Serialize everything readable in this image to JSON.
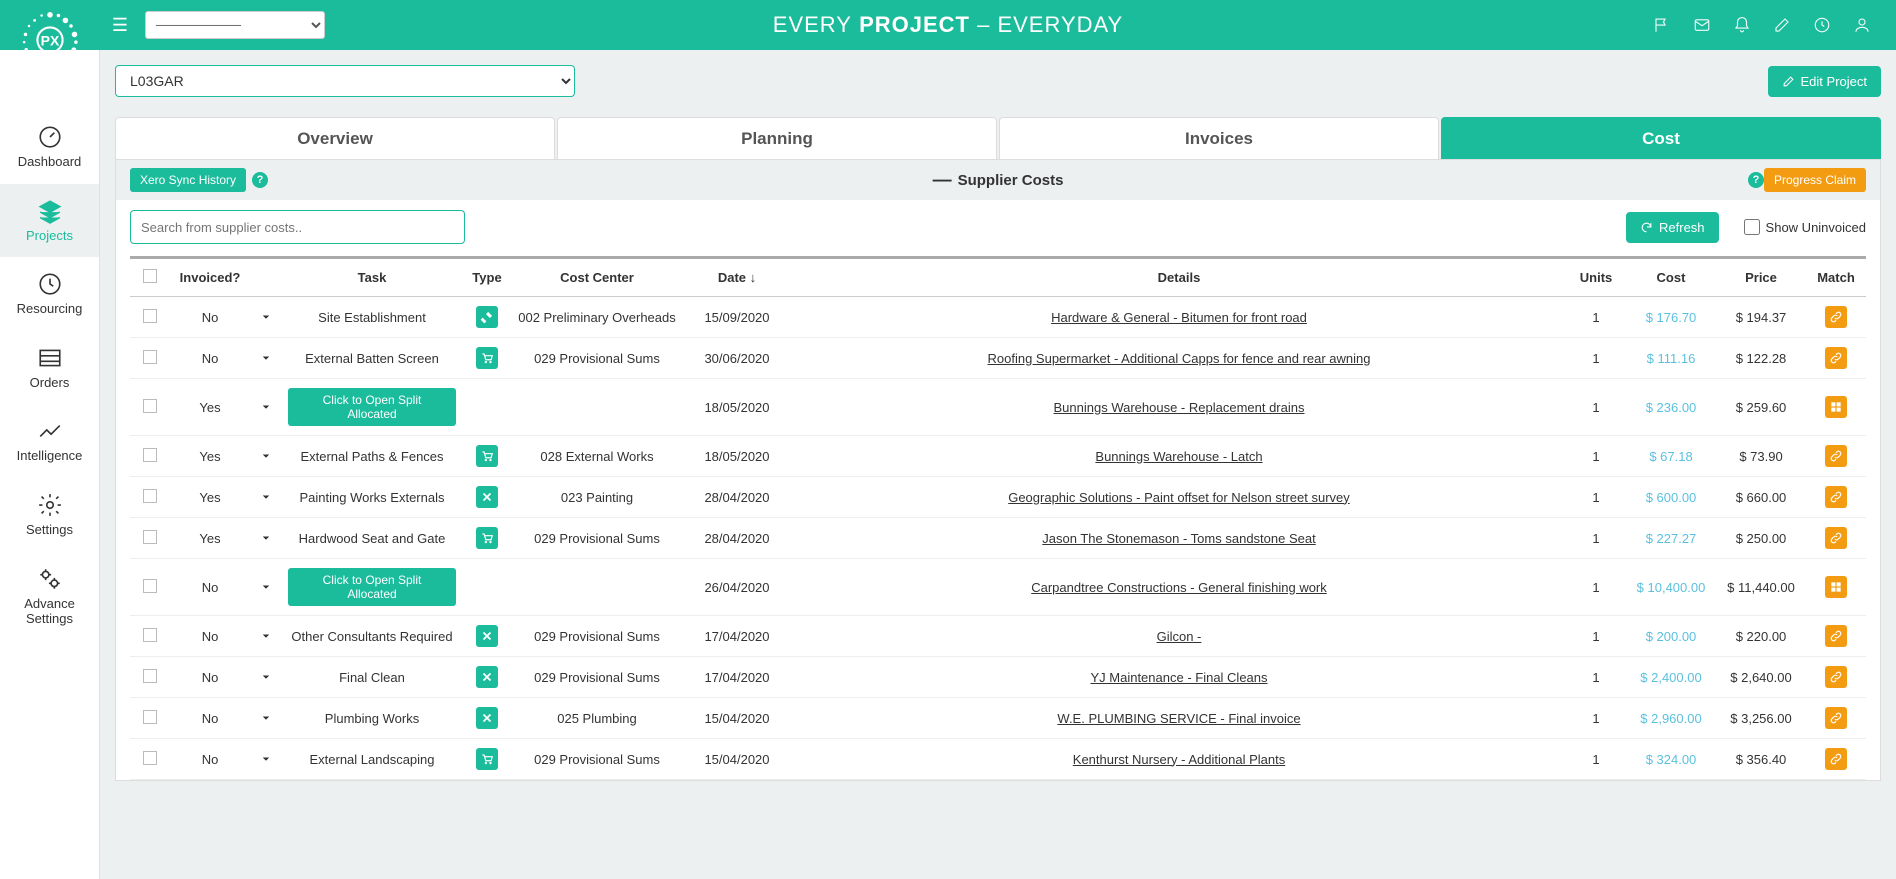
{
  "brand": {
    "pre": "EVERY",
    "mid": " PROJECT ",
    "post": "– EVERYDAY"
  },
  "sidebar": {
    "items": [
      {
        "label": "Dashboard",
        "icon": "gauge"
      },
      {
        "label": "Projects",
        "icon": "layers",
        "active": true
      },
      {
        "label": "Resourcing",
        "icon": "clock"
      },
      {
        "label": "Orders",
        "icon": "list"
      },
      {
        "label": "Intelligence",
        "icon": "pulse"
      },
      {
        "label": "Settings",
        "icon": "gear"
      },
      {
        "label": "Advance\nSettings",
        "icon": "gears"
      }
    ]
  },
  "project": {
    "selected": "L03GAR",
    "edit_label": "Edit Project"
  },
  "tabs": [
    "Overview",
    "Planning",
    "Invoices",
    "Cost"
  ],
  "active_tab": "Cost",
  "panel": {
    "xero_btn": "Xero Sync History",
    "title": "Supplier Costs",
    "progress_claim": "Progress Claim",
    "search_placeholder": "Search from supplier costs..",
    "refresh": "Refresh",
    "show_uninvoiced": "Show Uninvoiced"
  },
  "columns": {
    "invoiced": "Invoiced?",
    "task": "Task",
    "type": "Type",
    "cost_center": "Cost Center",
    "date": "Date",
    "details": "Details",
    "units": "Units",
    "cost": "Cost",
    "price": "Price",
    "match": "Match"
  },
  "sort_icon": "↓",
  "split_label": "Click to Open Split Allocated",
  "rows": [
    {
      "invoiced": "No",
      "task": "Site Establishment",
      "type": "hammer",
      "cc": "002 Preliminary Overheads",
      "date": "15/09/2020",
      "details": "Hardware & General - Bitumen for front road",
      "units": "1",
      "cost": "$ 176.70",
      "price": "$ 194.37",
      "match": "link"
    },
    {
      "invoiced": "No",
      "task": "External Batten Screen",
      "type": "cart",
      "cc": "029 Provisional Sums",
      "date": "30/06/2020",
      "details": "Roofing Supermarket - Additional Capps for fence and rear awning",
      "units": "1",
      "cost": "$ 111.16",
      "price": "$ 122.28",
      "match": "link"
    },
    {
      "invoiced": "Yes",
      "task": "__SPLIT__",
      "type": "",
      "cc": "",
      "date": "18/05/2020",
      "details": "Bunnings Warehouse - Replacement drains",
      "units": "1",
      "cost": "$ 236.00",
      "price": "$ 259.60",
      "match": "split"
    },
    {
      "invoiced": "Yes",
      "task": "External Paths & Fences",
      "type": "cart",
      "cc": "028 External Works",
      "date": "18/05/2020",
      "details": "Bunnings Warehouse - Latch",
      "units": "1",
      "cost": "$ 67.18",
      "price": "$ 73.90",
      "match": "link"
    },
    {
      "invoiced": "Yes",
      "task": "Painting Works Externals",
      "type": "tools",
      "cc": "023 Painting",
      "date": "28/04/2020",
      "details": "Geographic Solutions - Paint offset for Nelson street survey",
      "units": "1",
      "cost": "$ 600.00",
      "price": "$ 660.00",
      "match": "link"
    },
    {
      "invoiced": "Yes",
      "task": "Hardwood Seat and Gate",
      "type": "cart",
      "cc": "029 Provisional Sums",
      "date": "28/04/2020",
      "details": "Jason The Stonemason - Toms sandstone Seat",
      "units": "1",
      "cost": "$ 227.27",
      "price": "$ 250.00",
      "match": "link"
    },
    {
      "invoiced": "No",
      "task": "__SPLIT__",
      "type": "",
      "cc": "",
      "date": "26/04/2020",
      "details": "Carpandtree Constructions - General finishing work",
      "units": "1",
      "cost": "$ 10,400.00",
      "price": "$ 11,440.00",
      "match": "split"
    },
    {
      "invoiced": "No",
      "task": "Other Consultants Required",
      "type": "tools",
      "cc": "029 Provisional Sums",
      "date": "17/04/2020",
      "details": "Gilcon - ",
      "units": "1",
      "cost": "$ 200.00",
      "price": "$ 220.00",
      "match": "link"
    },
    {
      "invoiced": "No",
      "task": "Final Clean",
      "type": "tools",
      "cc": "029 Provisional Sums",
      "date": "17/04/2020",
      "details": "YJ Maintenance - Final Cleans",
      "units": "1",
      "cost": "$ 2,400.00",
      "price": "$ 2,640.00",
      "match": "link"
    },
    {
      "invoiced": "No",
      "task": "Plumbing Works",
      "type": "tools",
      "cc": "025 Plumbing",
      "date": "15/04/2020",
      "details": "W.E. PLUMBING SERVICE - Final invoice",
      "units": "1",
      "cost": "$ 2,960.00",
      "price": "$ 3,256.00",
      "match": "link"
    },
    {
      "invoiced": "No",
      "task": "External Landscaping",
      "type": "cart",
      "cc": "029 Provisional Sums",
      "date": "15/04/2020",
      "details": "Kenthurst Nursery - Additional Plants",
      "units": "1",
      "cost": "$ 324.00",
      "price": "$ 356.40",
      "match": "link"
    }
  ]
}
